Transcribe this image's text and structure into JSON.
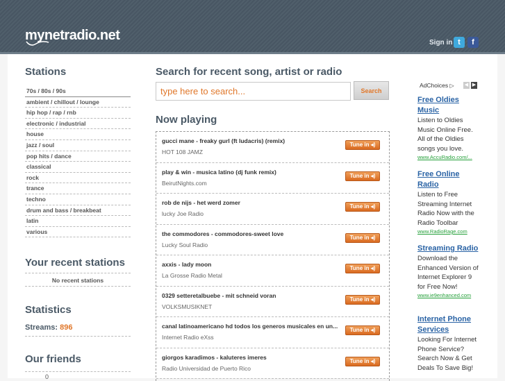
{
  "header": {
    "logo": "mynetradio.net",
    "signin": "Sign in",
    "twitter_glyph": "t",
    "facebook_glyph": "f"
  },
  "stations": {
    "title": "Stations",
    "items": [
      "70s / 80s / 90s",
      "ambient / chillout / lounge",
      "hip hop / rap / rnb",
      "electronic / industrial",
      "house",
      "jazz / soul",
      "pop hits / dance",
      "classical",
      "rock",
      "trance",
      "techno",
      "drum and bass / breakbeat",
      "latin",
      "various"
    ]
  },
  "recent": {
    "title": "Your recent stations",
    "empty": "No recent stations"
  },
  "statistics": {
    "title": "Statistics",
    "label": "Streams:",
    "value": "896"
  },
  "friends": {
    "title": "Our friends",
    "count": "0"
  },
  "search": {
    "title": "Search for recent song, artist or radio",
    "placeholder": "type here to search...",
    "button": "Search"
  },
  "now_playing": {
    "title": "Now playing",
    "tune_label": "Tune in ◂)",
    "rows": [
      {
        "song": "gucci mane - freaky gurl (ft ludacris) (remix)",
        "station": "HOT 108 JAMZ"
      },
      {
        "song": "play & win - musica latino (dj funk remix)",
        "station": "BeirutNights.com"
      },
      {
        "song": "rob de nijs - het werd zomer",
        "station": "lucky Joe Radio"
      },
      {
        "song": "the commodores - commodores-sweet love",
        "station": "Lucky Soul Radio"
      },
      {
        "song": "axxis - lady moon",
        "station": "La Grosse Radio Metal"
      },
      {
        "song": "0329 setteretalbuebe - mit schneid voran",
        "station": "VOLKSMUSIKNET"
      },
      {
        "song": "canal latinoamericano hd todos los generos musicales en un...",
        "station": "Internet Radio eXss"
      },
      {
        "song": "giorgos karadimos - kaluteres imeres",
        "station": "Radio Universidad de Puerto Rico"
      }
    ]
  },
  "ads": {
    "adchoices": "AdChoices",
    "adchoices_icon": "play-triangle-icon",
    "items": [
      {
        "title": "Free Oldies Music",
        "body": "Listen to Oldies Music Online Free. All of the Oldies songs you love.",
        "url": "www.AccuRadio.com/..."
      },
      {
        "title": "Free Online Radio",
        "body": "Listen to Free Streaming Internet Radio Now with the Radio Toolbar",
        "url": "www.RadioRage.com"
      },
      {
        "title": "Streaming Radio",
        "body": "Download the Enhanced Version of Internet Explorer 9 for Free Now!",
        "url": "www.ie9enhanced.com"
      },
      {
        "title": "Internet Phone Services",
        "body": "Looking For Internet Phone Service? Search Now & Get Deals To Save Big!",
        "url": ""
      }
    ]
  },
  "colors": {
    "header": "#4a5966",
    "accent": "#e0772a",
    "link": "#2a63a5",
    "ad_url": "#25a03a"
  }
}
